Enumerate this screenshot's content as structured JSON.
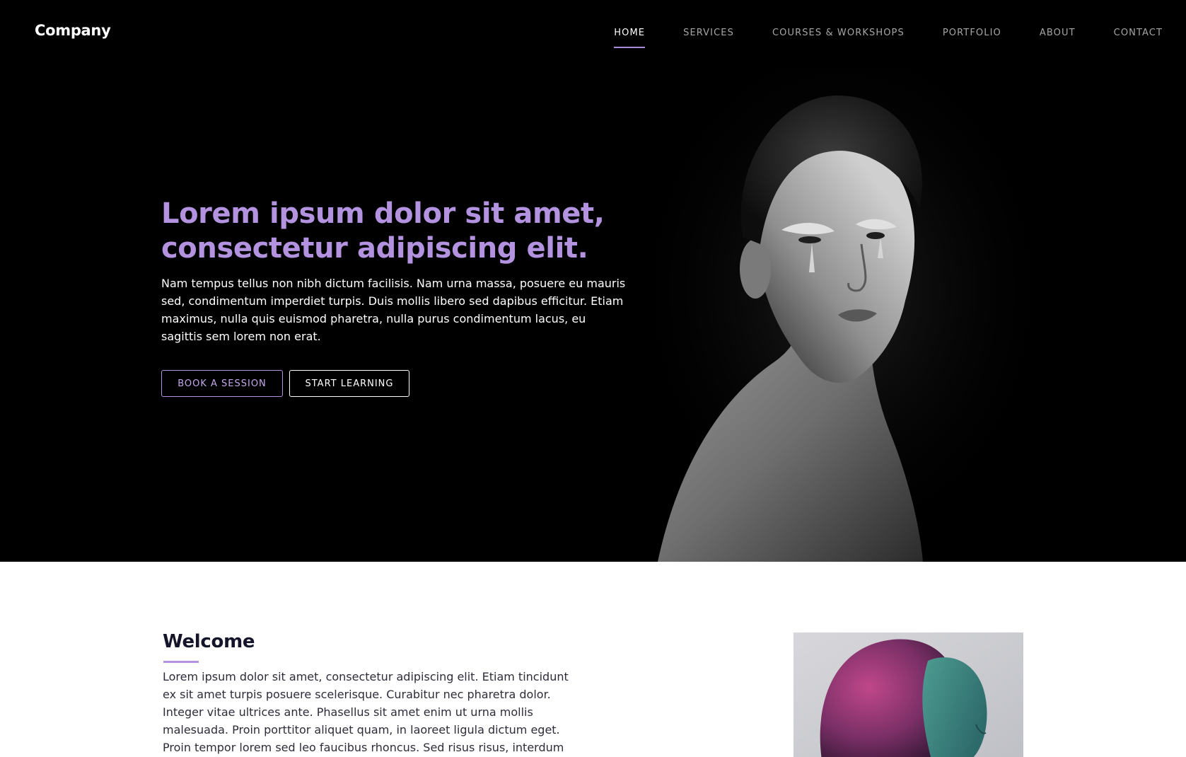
{
  "header": {
    "logo": "Company",
    "nav": [
      {
        "label": "HOME",
        "active": true
      },
      {
        "label": "SERVICES",
        "active": false
      },
      {
        "label": "COURSES & WORKSHOPS",
        "active": false
      },
      {
        "label": "PORTFOLIO",
        "active": false
      },
      {
        "label": "ABOUT",
        "active": false
      },
      {
        "label": "CONTACT",
        "active": false
      }
    ]
  },
  "hero": {
    "title": "Lorem ipsum dolor sit amet, consectetur adipiscing elit.",
    "body": "Nam tempus tellus non nibh dictum facilisis. Nam urna massa, posuere eu mauris sed, condimentum imperdiet turpis. Duis mollis libero sed dapibus efficitur. Etiam maximus, nulla quis euismod pharetra, nulla purus condimentum lacus, eu sagittis sem lorem non erat.",
    "buttons": {
      "book": "BOOK A SESSION",
      "learn": "START LEARNING"
    }
  },
  "welcome": {
    "title": "Welcome",
    "body": "Lorem ipsum dolor sit amet, consectetur adipiscing elit. Etiam tincidunt ex sit amet turpis posuere scelerisque. Curabitur nec pharetra dolor. Integer vitae ultrices ante. Phasellus sit amet enim ut urna mollis malesuada. Proin porttitor aliquet quam, in laoreet ligula dictum eget. Proin tempor lorem sed leo faucibus rhoncus. Sed risus risus, interdum"
  },
  "colors": {
    "accent": "#b393e0",
    "hero_background": "#000000",
    "heading_dark": "#14142b"
  }
}
